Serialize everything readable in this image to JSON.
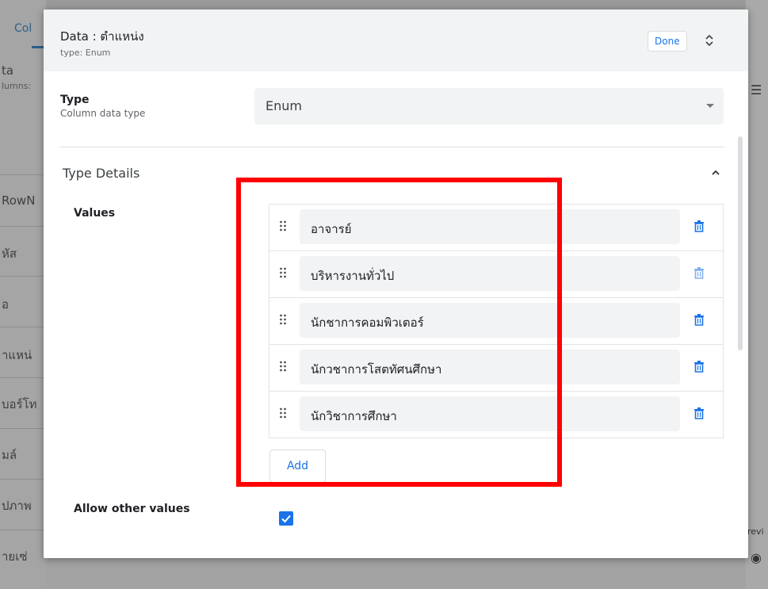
{
  "background": {
    "left_tab": "Col",
    "left_labels": [
      "ta",
      "lumns:",
      "RowN",
      "หัส",
      "อ",
      "าแหน่",
      "บอร์โท",
      "มล์",
      "ปภาพ",
      "ายเซ่"
    ],
    "right_footer": "revi"
  },
  "dialog": {
    "title": "Data : ตำแหน่ง",
    "subtitle": "type: Enum",
    "done_label": "Done",
    "type_label": "Type",
    "type_sublabel": "Column data type",
    "type_value": "Enum",
    "section_title": "Type Details",
    "values_label": "Values",
    "values": [
      "อาจารย์",
      "บริหารงานทั่วไป",
      "นักชาการคอมพิวเตอร์",
      "นักวชาการโสตทัศนศึกษา",
      "นักวิชาการศึกษา"
    ],
    "add_label": "Add",
    "allow_other_label": "Allow other values",
    "allow_other_checked": true
  },
  "colors": {
    "accent": "#1a73e8",
    "highlight": "#ff0000"
  }
}
